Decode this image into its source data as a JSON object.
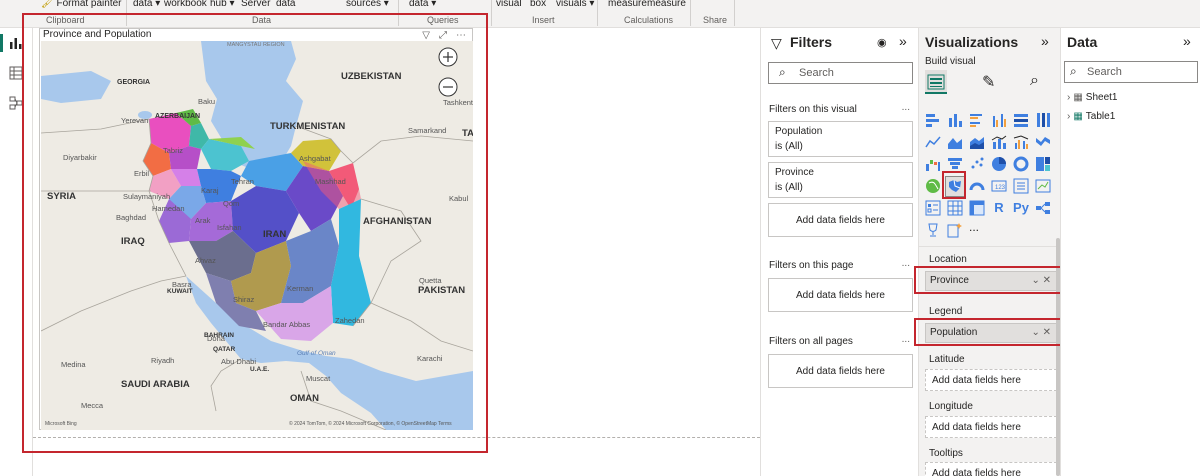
{
  "ribbon": {
    "buttons": [
      "Format painter",
      "data",
      "workbook",
      "hub",
      "Server",
      "data",
      "sources",
      "data",
      "visual",
      "box",
      "visuals",
      "measure",
      "measure"
    ],
    "groups": [
      "Clipboard",
      "Data",
      "Queries",
      "Insert",
      "Calculations",
      "Share"
    ]
  },
  "visual": {
    "title": "Province and Population",
    "map": {
      "countries": [
        "UZBEKISTAN",
        "TURKMENISTAN",
        "GEORGIA",
        "AZERBAIJAN",
        "SYRIA",
        "IRAQ",
        "IRAN",
        "AFGHANISTAN",
        "KUWAIT",
        "BAHRAIN",
        "QATAR",
        "U.A.E.",
        "SAUDI ARABIA",
        "OMAN",
        "PAKISTAN",
        "TA"
      ],
      "cities": [
        "Baku",
        "Yerevan",
        "Tabriz",
        "Diyarbakir",
        "Erbil",
        "Sulaymaniyah",
        "Hamedan",
        "Baghdad",
        "Karaj",
        "Tehran",
        "Qom",
        "Isfahan",
        "Arak",
        "Ahvaz",
        "Basra",
        "Shiraz",
        "Kerman",
        "Zahedan",
        "Mashhad",
        "Ashgabat",
        "Samarkand",
        "Tashkent",
        "Kabul",
        "Quetta",
        "Karachi",
        "Bandar Abbas",
        "Abu Dhabi",
        "Doha",
        "Muscat",
        "Riyadh",
        "Medina",
        "Mecca",
        "Gulf of Oman",
        "MANGYSTAU REGION"
      ],
      "attribution": "© 2024 TomTom, © 2024 Microsoft Corporation, © OpenStreetMap   Terms",
      "bing_logo": "Microsoft Bing"
    }
  },
  "filters": {
    "title": "Filters",
    "search_placeholder": "Search",
    "on_visual_label": "Filters on this visual",
    "cards": [
      {
        "field": "Population",
        "state": "is (All)"
      },
      {
        "field": "Province",
        "state": "is (All)"
      }
    ],
    "add_fields": "Add data fields here",
    "on_page_label": "Filters on this page",
    "on_all_pages_label": "Filters on all pages",
    "dots": "..."
  },
  "visualizations": {
    "title": "Visualizations",
    "build_visual": "Build visual",
    "wells": {
      "location_label": "Location",
      "location_value": "Province",
      "legend_label": "Legend",
      "legend_value": "Population",
      "latitude_label": "Latitude",
      "longitude_label": "Longitude",
      "tooltips_label": "Tooltips",
      "add_fields": "Add data fields here"
    },
    "r_label": "R",
    "py_label": "Py",
    "more": "..."
  },
  "data_pane": {
    "title": "Data",
    "search_placeholder": "Search",
    "tables": [
      "Sheet1",
      "Table1"
    ]
  },
  "colors": {
    "accent_red": "#c4262e",
    "ribbon_bg": "#f3f2f1",
    "pane_bg": "#f3f2f1"
  }
}
